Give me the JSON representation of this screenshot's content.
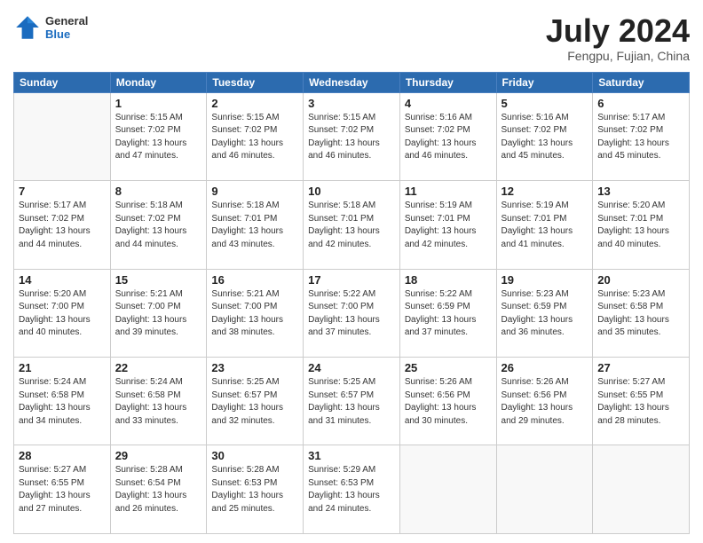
{
  "header": {
    "logo_general": "General",
    "logo_blue": "Blue",
    "title": "July 2024",
    "location": "Fengpu, Fujian, China"
  },
  "days_of_week": [
    "Sunday",
    "Monday",
    "Tuesday",
    "Wednesday",
    "Thursday",
    "Friday",
    "Saturday"
  ],
  "weeks": [
    [
      {
        "day": "",
        "sunrise": "",
        "sunset": "",
        "daylight": ""
      },
      {
        "day": "1",
        "sunrise": "5:15 AM",
        "sunset": "7:02 PM",
        "daylight": "13 hours and 47 minutes."
      },
      {
        "day": "2",
        "sunrise": "5:15 AM",
        "sunset": "7:02 PM",
        "daylight": "13 hours and 46 minutes."
      },
      {
        "day": "3",
        "sunrise": "5:15 AM",
        "sunset": "7:02 PM",
        "daylight": "13 hours and 46 minutes."
      },
      {
        "day": "4",
        "sunrise": "5:16 AM",
        "sunset": "7:02 PM",
        "daylight": "13 hours and 46 minutes."
      },
      {
        "day": "5",
        "sunrise": "5:16 AM",
        "sunset": "7:02 PM",
        "daylight": "13 hours and 45 minutes."
      },
      {
        "day": "6",
        "sunrise": "5:17 AM",
        "sunset": "7:02 PM",
        "daylight": "13 hours and 45 minutes."
      }
    ],
    [
      {
        "day": "7",
        "sunrise": "5:17 AM",
        "sunset": "7:02 PM",
        "daylight": "13 hours and 44 minutes."
      },
      {
        "day": "8",
        "sunrise": "5:18 AM",
        "sunset": "7:02 PM",
        "daylight": "13 hours and 44 minutes."
      },
      {
        "day": "9",
        "sunrise": "5:18 AM",
        "sunset": "7:01 PM",
        "daylight": "13 hours and 43 minutes."
      },
      {
        "day": "10",
        "sunrise": "5:18 AM",
        "sunset": "7:01 PM",
        "daylight": "13 hours and 42 minutes."
      },
      {
        "day": "11",
        "sunrise": "5:19 AM",
        "sunset": "7:01 PM",
        "daylight": "13 hours and 42 minutes."
      },
      {
        "day": "12",
        "sunrise": "5:19 AM",
        "sunset": "7:01 PM",
        "daylight": "13 hours and 41 minutes."
      },
      {
        "day": "13",
        "sunrise": "5:20 AM",
        "sunset": "7:01 PM",
        "daylight": "13 hours and 40 minutes."
      }
    ],
    [
      {
        "day": "14",
        "sunrise": "5:20 AM",
        "sunset": "7:00 PM",
        "daylight": "13 hours and 40 minutes."
      },
      {
        "day": "15",
        "sunrise": "5:21 AM",
        "sunset": "7:00 PM",
        "daylight": "13 hours and 39 minutes."
      },
      {
        "day": "16",
        "sunrise": "5:21 AM",
        "sunset": "7:00 PM",
        "daylight": "13 hours and 38 minutes."
      },
      {
        "day": "17",
        "sunrise": "5:22 AM",
        "sunset": "7:00 PM",
        "daylight": "13 hours and 37 minutes."
      },
      {
        "day": "18",
        "sunrise": "5:22 AM",
        "sunset": "6:59 PM",
        "daylight": "13 hours and 37 minutes."
      },
      {
        "day": "19",
        "sunrise": "5:23 AM",
        "sunset": "6:59 PM",
        "daylight": "13 hours and 36 minutes."
      },
      {
        "day": "20",
        "sunrise": "5:23 AM",
        "sunset": "6:58 PM",
        "daylight": "13 hours and 35 minutes."
      }
    ],
    [
      {
        "day": "21",
        "sunrise": "5:24 AM",
        "sunset": "6:58 PM",
        "daylight": "13 hours and 34 minutes."
      },
      {
        "day": "22",
        "sunrise": "5:24 AM",
        "sunset": "6:58 PM",
        "daylight": "13 hours and 33 minutes."
      },
      {
        "day": "23",
        "sunrise": "5:25 AM",
        "sunset": "6:57 PM",
        "daylight": "13 hours and 32 minutes."
      },
      {
        "day": "24",
        "sunrise": "5:25 AM",
        "sunset": "6:57 PM",
        "daylight": "13 hours and 31 minutes."
      },
      {
        "day": "25",
        "sunrise": "5:26 AM",
        "sunset": "6:56 PM",
        "daylight": "13 hours and 30 minutes."
      },
      {
        "day": "26",
        "sunrise": "5:26 AM",
        "sunset": "6:56 PM",
        "daylight": "13 hours and 29 minutes."
      },
      {
        "day": "27",
        "sunrise": "5:27 AM",
        "sunset": "6:55 PM",
        "daylight": "13 hours and 28 minutes."
      }
    ],
    [
      {
        "day": "28",
        "sunrise": "5:27 AM",
        "sunset": "6:55 PM",
        "daylight": "13 hours and 27 minutes."
      },
      {
        "day": "29",
        "sunrise": "5:28 AM",
        "sunset": "6:54 PM",
        "daylight": "13 hours and 26 minutes."
      },
      {
        "day": "30",
        "sunrise": "5:28 AM",
        "sunset": "6:53 PM",
        "daylight": "13 hours and 25 minutes."
      },
      {
        "day": "31",
        "sunrise": "5:29 AM",
        "sunset": "6:53 PM",
        "daylight": "13 hours and 24 minutes."
      },
      {
        "day": "",
        "sunrise": "",
        "sunset": "",
        "daylight": ""
      },
      {
        "day": "",
        "sunrise": "",
        "sunset": "",
        "daylight": ""
      },
      {
        "day": "",
        "sunrise": "",
        "sunset": "",
        "daylight": ""
      }
    ]
  ]
}
